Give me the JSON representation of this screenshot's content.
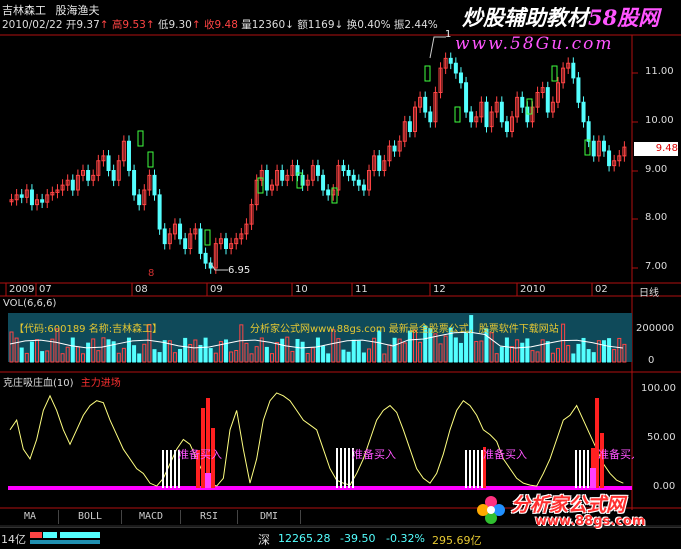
{
  "header": {
    "stock_name": "吉林森工",
    "tag": "股海渔夫",
    "date": "2010/02/22",
    "open": "开9.37",
    "open_arrow": "↑",
    "high": "高9.53",
    "high_arrow": "↑",
    "low": "低9.30",
    "low_arrow": "↑",
    "close": "收9.48",
    "volume": "量12360",
    "vol_arrow": "↓",
    "amount": "额1169",
    "amt_arrow": "↓",
    "turnover": "换0.40%",
    "amplitude": "振2.44%"
  },
  "watermark_top": "炒股辅助教材",
  "watermark_top_site": "58股网",
  "watermark_top_url": "www.58Gu.com",
  "price_axis": [
    "11.00",
    "10.00",
    "9.00",
    "8.00",
    "7.00"
  ],
  "current_price": "9.48",
  "high_marker": "1",
  "low_marker": "6.95",
  "low_marker_small": "8",
  "time_axis": [
    "2009",
    "07",
    "08",
    "09",
    "10",
    "11",
    "12",
    "2010",
    "02"
  ],
  "period": "日线",
  "vol_panel": {
    "title": "VOL(6,6,6)",
    "axis_1": "200000",
    "axis_0": "0",
    "info_banner": "【代码:600189 名称:吉林森工】",
    "ad_banner": "分析家公式网www.88gs.com 最新最全股票公式，股票软件下载网站"
  },
  "indicator": {
    "title": "克庄吸庄血(10)",
    "subtitle": "主力进场",
    "axis": [
      "100.00",
      "50.00",
      "0.00"
    ],
    "signal_label": "准备买入"
  },
  "tabs": [
    "MA",
    "BOLL",
    "MACD",
    "RSI",
    "DMI"
  ],
  "status": {
    "left": "14亿",
    "market": "深",
    "index": "12265.28",
    "change": "-39.50",
    "pct": "-0.32%",
    "amount": "295.69亿"
  },
  "logo_text": "分析家公式网",
  "logo_url": "www.88gs.com",
  "colors": {
    "up": "#ff4444",
    "down": "#54ffff",
    "axis": "#b01010"
  }
}
